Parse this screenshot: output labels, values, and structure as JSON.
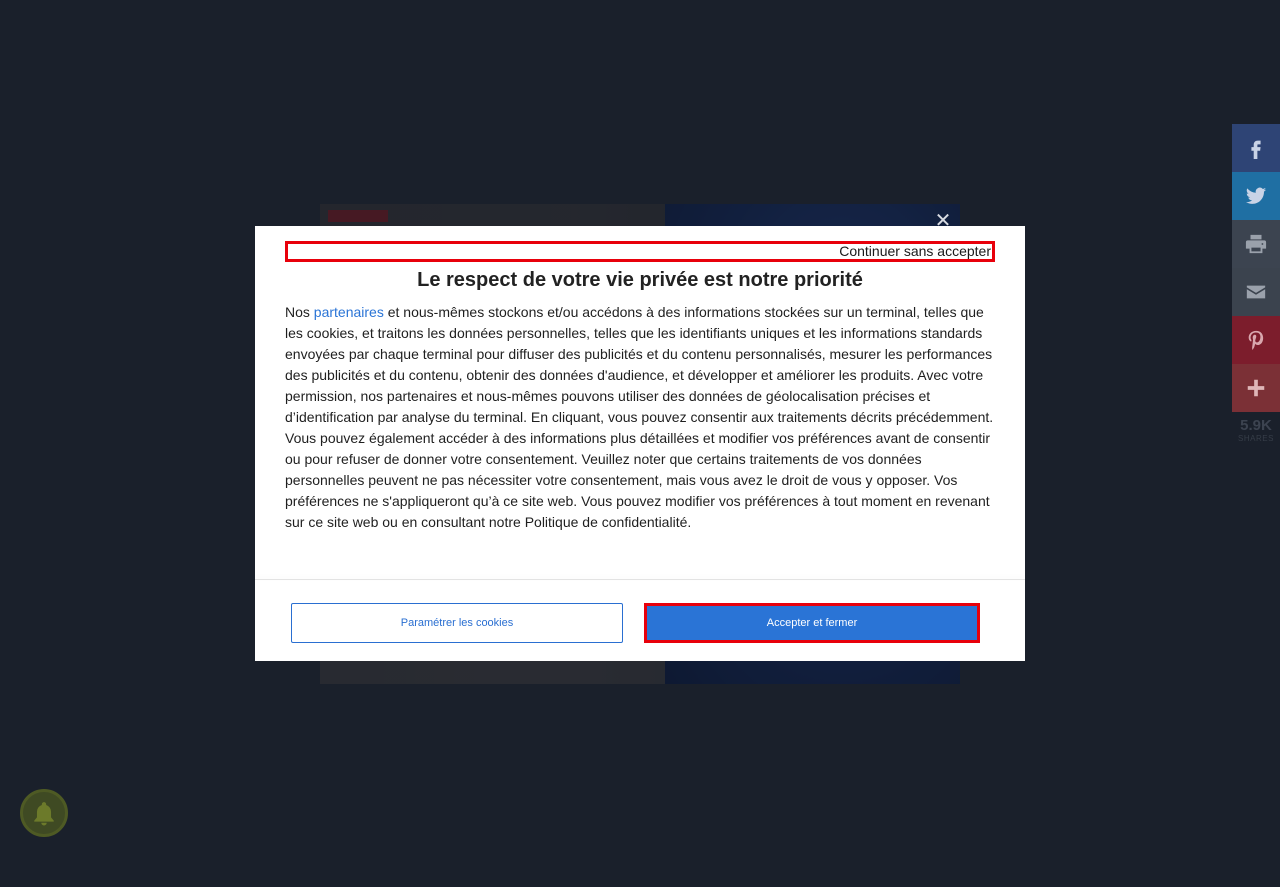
{
  "consent": {
    "skip_label": "Continuer sans accepter",
    "title": "Le respect de votre vie privée est notre priorité",
    "body_prefix": "Nos ",
    "partners_link": "partenaires",
    "body_text": " et nous-mêmes stockons et/ou accédons à des informations stockées sur un terminal, telles que les cookies, et traitons les données personnelles, telles que les identifiants uniques et les informations standards envoyées par chaque terminal pour diffuser des publicités et du contenu personnalisés, mesurer les performances des publicités et du contenu, obtenir des données d'audience, et développer et améliorer les produits. Avec votre permission, nos partenaires et nous-mêmes pouvons utiliser des données de géolocalisation précises et d’identification par analyse du terminal. En cliquant, vous pouvez consentir aux traitements décrits précédemment. Vous pouvez également accéder à des informations plus détaillées et modifier vos préférences avant de consentir ou pour refuser de donner votre consentement. Veuillez noter que certains traitements de vos données personnelles peuvent ne pas nécessiter votre consentement, mais vous avez le droit de vous y opposer. Vos préférences ne s'appliqueront qu’à ce site web. Vous pouvez modifier vos préférences à tout moment en revenant sur ce site web ou en consultant notre Politique de confidentialité.",
    "settings_button": "Paramétrer les cookies",
    "accept_button": "Accepter et fermer"
  },
  "ad": {
    "close_icon": "close-icon"
  },
  "share": {
    "count": "5.9K",
    "count_label": "SHARES",
    "buttons": [
      "facebook-icon",
      "twitter-icon",
      "print-icon",
      "email-icon",
      "pinterest-icon",
      "more-icon"
    ],
    "colors": {
      "facebook": "#2e4475",
      "twitter": "#1f6fa3",
      "pinterest": "#7c1d2c"
    }
  },
  "notification": {
    "icon": "bell-icon"
  },
  "colors": {
    "page_bg": "#1a202b",
    "accent": "#2a74d6",
    "highlight": "#e8000b"
  }
}
